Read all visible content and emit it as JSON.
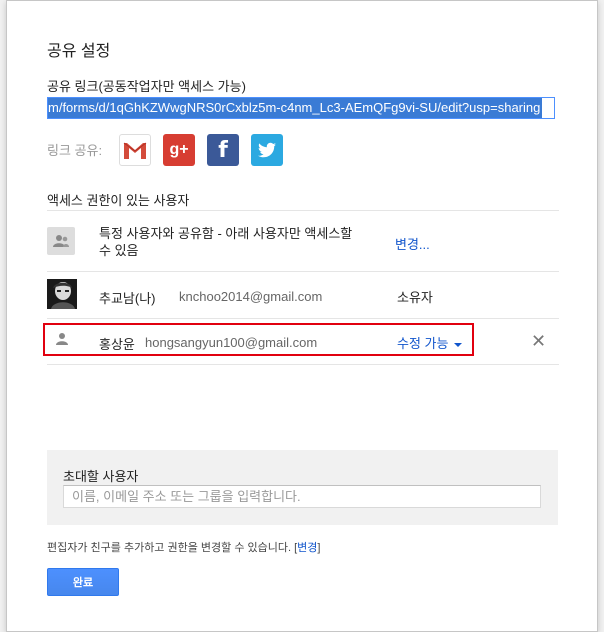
{
  "dialog": {
    "title": "공유 설정",
    "link_label": "공유 링크(공동작업자만 액세스 가능)",
    "link_value": "m/forms/d/1qGhKZWwgNRS0rCxblz5m-c4nm_Lc3-AEmQFg9vi-SU/edit?usp=sharing",
    "share_label": "링크 공유:",
    "social": [
      "gmail-icon",
      "google-plus-icon",
      "facebook-icon",
      "twitter-icon"
    ],
    "google_plus_text": "g+",
    "facebook_text": "f",
    "access_header": "액세스 권한이 있는 사용자",
    "rows": [
      {
        "name": "특정 사용자와 공유함 - 아래 사용자만 액세스할 수 있음",
        "action": "변경..."
      },
      {
        "name": "추교남(나)",
        "email": "knchoo2014@gmail.com",
        "role": "소유자"
      },
      {
        "name": "홍상윤",
        "email": "hongsangyun100@gmail.com",
        "role": "수정 가능"
      }
    ],
    "remove_symbol": "✕",
    "invite": {
      "label": "초대할 사용자",
      "placeholder": "이름, 이메일 주소 또는 그룹을 입력합니다."
    },
    "footnote_text": "편집자가 친구를 추가하고 권한을 변경할 수 있습니다. [",
    "footnote_link": "변경",
    "footnote_end": "]",
    "done_label": "완료"
  },
  "colors": {
    "accent": "#4d90fe",
    "link": "#1155cc",
    "highlight": "#e1000f"
  }
}
